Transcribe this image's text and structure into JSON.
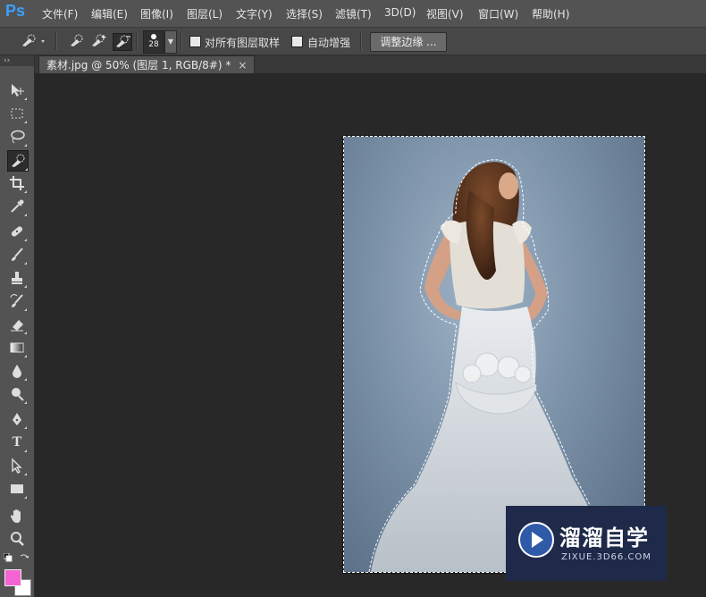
{
  "app": {
    "logo": "Ps"
  },
  "menubar": {
    "items": [
      "文件(F)",
      "编辑(E)",
      "图像(I)",
      "图层(L)",
      "文字(Y)",
      "选择(S)",
      "滤镜(T)",
      "3D(D)",
      "视图(V)",
      "窗口(W)",
      "帮助(H)"
    ]
  },
  "options": {
    "brush_size": "28",
    "sample_all_layers_label": "对所有图层取样",
    "sample_all_layers_checked": false,
    "auto_enhance_label": "自动增强",
    "auto_enhance_checked": false,
    "refine_edge_label": "调整边缘 ..."
  },
  "toolbox": {
    "active_tool": "quick-selection",
    "tools": [
      "move",
      "marquee",
      "lasso",
      "quick-selection",
      "crop",
      "eyedropper",
      "healing-brush",
      "brush",
      "clone-stamp",
      "history-brush",
      "eraser",
      "gradient",
      "blur",
      "dodge",
      "pen",
      "type",
      "path-selection",
      "rectangle",
      "hand",
      "zoom"
    ],
    "type_tool_glyph": "T",
    "foreground_color": "#f564d4",
    "background_color": "#ffffff"
  },
  "document": {
    "tab_title": "素材.jpg @ 50% (图层 1, RGB/8#) *",
    "close_glyph": "×"
  },
  "watermark": {
    "title": "溜溜自学",
    "url": "ZIXUE.3D66.COM"
  },
  "colors": {
    "menubar": "#535353",
    "optbar": "#474747",
    "canvas": "#282828",
    "accent": "#3aa0ff"
  }
}
